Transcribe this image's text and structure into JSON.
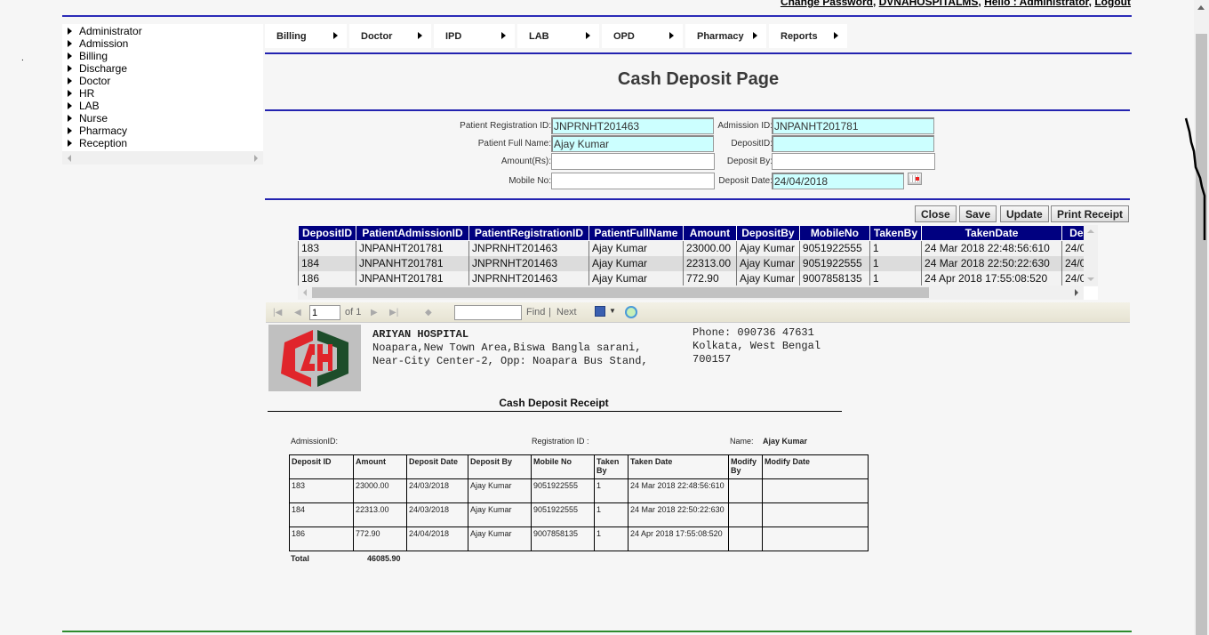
{
  "header": {
    "links": [
      "Change Password",
      "DVNAHOSPITALMS",
      "Hello : Administrator",
      "Logout"
    ]
  },
  "sidebar": {
    "items": [
      "Administrator",
      "Admission",
      "Billing",
      "Discharge",
      "Doctor",
      "HR",
      "LAB",
      "Nurse",
      "Pharmacy",
      "Reception"
    ]
  },
  "menu": {
    "items": [
      "Billing",
      "Doctor",
      "IPD",
      "LAB",
      "OPD",
      "Pharmacy",
      "Reports"
    ]
  },
  "page": {
    "title": "Cash Deposit Page"
  },
  "form": {
    "registration_id": {
      "label": "Patient Registration ID:",
      "value": "JNPRNHT201463"
    },
    "admission_id": {
      "label": "Admission ID:",
      "value": "JNPANHT201781"
    },
    "full_name": {
      "label": "Patient Full Name:",
      "value": "Ajay Kumar"
    },
    "deposit_id": {
      "label": "DepositID:",
      "value": ""
    },
    "amount": {
      "label": "Amount(Rs):",
      "value": ""
    },
    "deposit_by": {
      "label": "Deposit By:",
      "value": ""
    },
    "mobile": {
      "label": "Mobile No:",
      "value": ""
    },
    "deposit_date": {
      "label": "Deposit Date:",
      "value": "24/04/2018"
    }
  },
  "buttons": {
    "close": "Close",
    "save": "Save",
    "update": "Update",
    "print": "Print Receipt"
  },
  "grid": {
    "columns": [
      "DepositID",
      "PatientAdmissionID",
      "PatientRegistrationID",
      "PatientFullName",
      "Amount",
      "DepositBy",
      "MobileNo",
      "TakenBy",
      "TakenDate",
      "Dep"
    ],
    "rows": [
      [
        "183",
        "JNPANHT201781",
        "JNPRNHT201463",
        "Ajay Kumar",
        "23000.00",
        "Ajay Kumar",
        "9051922555",
        "1",
        "24 Mar 2018 22:48:56:610",
        "24/0"
      ],
      [
        "184",
        "JNPANHT201781",
        "JNPRNHT201463",
        "Ajay Kumar",
        "22313.00",
        "Ajay Kumar",
        "9051922555",
        "1",
        "24 Mar 2018 22:50:22:630",
        "24/0"
      ],
      [
        "186",
        "JNPANHT201781",
        "JNPRNHT201463",
        "Ajay Kumar",
        "772.90",
        "Ajay Kumar",
        "9007858135",
        "1",
        "24 Apr 2018 17:55:08:520",
        "24/0"
      ]
    ]
  },
  "report_toolbar": {
    "page": "1",
    "of_label": "of 1",
    "find_label": "Find",
    "separator": "|",
    "next_label": "Next"
  },
  "receipt": {
    "hospital_name": "ARIYAN HOSPITAL",
    "address_line1": "Noapara,New Town Area,Biswa Bangla sarani,",
    "address_line2": "Near-City Center-2, Opp: Noapara Bus Stand,",
    "phone": "Phone: 090736 47631",
    "city": "Kolkata, West Bengal",
    "pin": "700157",
    "title": "Cash Deposit  Receipt",
    "admission_label": "AdmissionID:",
    "registration_label": "Registration ID :",
    "name_label": "Name:",
    "name_value": "Ajay Kumar",
    "columns": [
      "Deposit ID",
      "Amount",
      "Deposit Date",
      "Deposit By",
      "Mobile No",
      "Taken By",
      "Taken Date",
      "Modify By",
      "Modify Date"
    ],
    "rows": [
      [
        "183",
        "23000.00",
        "24/03/2018",
        "Ajay Kumar",
        "9051922555",
        "1",
        "24 Mar 2018 22:48:56:610",
        "",
        ""
      ],
      [
        "184",
        "22313.00",
        "24/03/2018",
        "Ajay Kumar",
        "9051922555",
        "1",
        "24 Mar 2018 22:50:22:630",
        "",
        ""
      ],
      [
        "186",
        "772.90",
        "24/04/2018",
        "Ajay Kumar",
        "9007858135",
        "1",
        "24 Apr 2018 17:55:08:520",
        "",
        ""
      ]
    ],
    "total_label": "Total",
    "total_value": "46085.90"
  },
  "colors": {
    "grid_header": "#000080",
    "readonly_field": "#ccffff",
    "rule_blue": "#2323b0",
    "logo_red": "#e0252b",
    "logo_green": "#1d4d2a"
  }
}
